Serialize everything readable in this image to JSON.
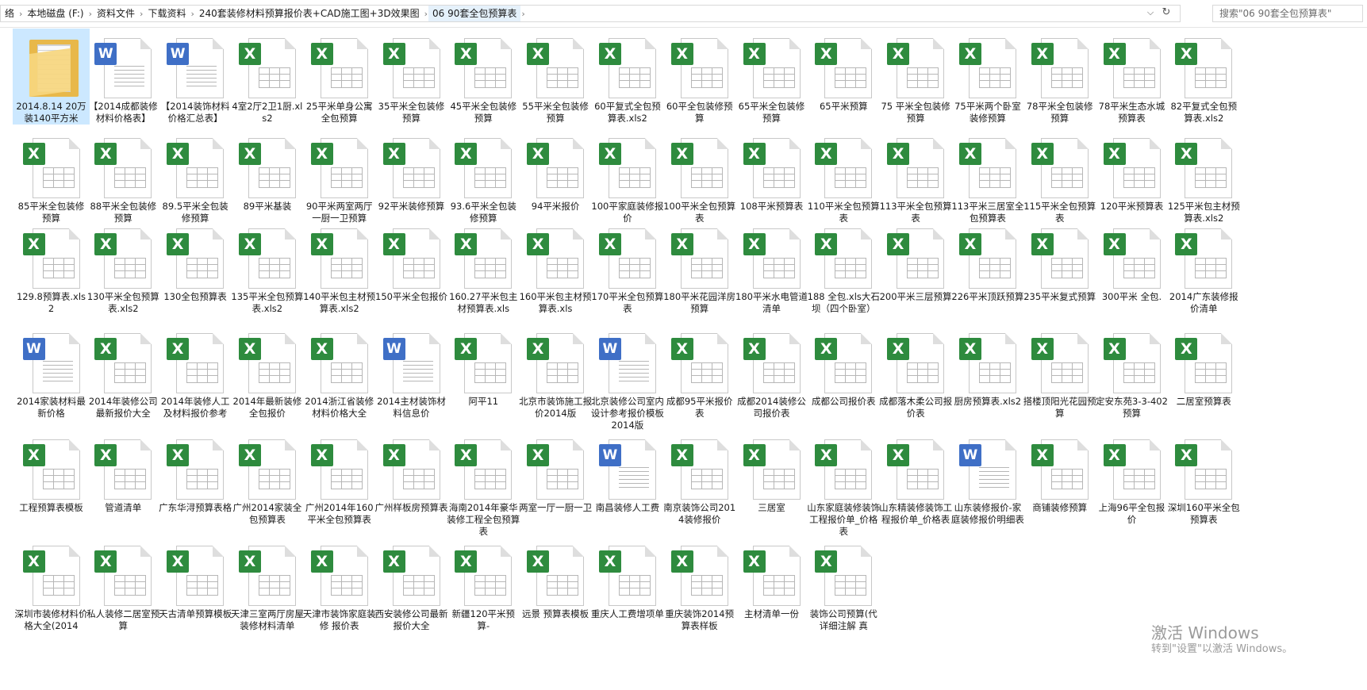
{
  "address": {
    "breadcrumbs": [
      "络",
      "本地磁盘 (F:)",
      "资料文件",
      "下载资料",
      "240套装修材料预算报价表+CAD施工图+3D效果图",
      "06 90套全包预算表"
    ],
    "separator": "›"
  },
  "icons": {
    "dropdown": "⌵",
    "refresh": "↻",
    "excel_letter": "X",
    "word_letter": "W"
  },
  "search": {
    "placeholder": "搜索\"06 90套全包预算表\""
  },
  "colors": {
    "excel_badge": "#2e8b3e",
    "word_badge": "#3f6fc6",
    "selection": "#cce8ff"
  },
  "files": [
    {
      "name": "2014.8.14 20万装140平方米",
      "type": "folder",
      "selected": true
    },
    {
      "name": "【2014成都装修材料价格表】",
      "type": "word"
    },
    {
      "name": "【2014装饰材料价格汇总表】",
      "type": "word"
    },
    {
      "name": "4室2厅2卫1厨.xls2",
      "type": "excel"
    },
    {
      "name": "25平米单身公寓全包预算",
      "type": "excel"
    },
    {
      "name": "35平米全包装修预算",
      "type": "excel"
    },
    {
      "name": "45平米全包装修预算",
      "type": "excel"
    },
    {
      "name": "55平米全包装修预算",
      "type": "excel"
    },
    {
      "name": "60平复式全包预算表.xls2",
      "type": "excel"
    },
    {
      "name": "60平全包装修预算",
      "type": "excel"
    },
    {
      "name": "65平米全包装修预算",
      "type": "excel"
    },
    {
      "name": "65平米预算",
      "type": "excel"
    },
    {
      "name": "75 平米全包装修预算",
      "type": "excel"
    },
    {
      "name": "75平米两个卧室装修预算",
      "type": "excel"
    },
    {
      "name": "78平米全包装修预算",
      "type": "excel"
    },
    {
      "name": "78平米生态水城预算表",
      "type": "excel"
    },
    {
      "name": "82平复式全包预算表.xls2",
      "type": "excel"
    },
    {
      "name": "85平米全包装修预算",
      "type": "excel"
    },
    {
      "name": "88平米全包装修预算",
      "type": "excel"
    },
    {
      "name": "89.5平米全包装修预算",
      "type": "excel"
    },
    {
      "name": "89平米基装",
      "type": "excel"
    },
    {
      "name": "90平米两室两厅一厨一卫预算",
      "type": "excel"
    },
    {
      "name": "92平米装修预算",
      "type": "excel"
    },
    {
      "name": "93.6平米全包装修预算",
      "type": "excel"
    },
    {
      "name": "94平米报价",
      "type": "excel"
    },
    {
      "name": "100平家庭装修报价",
      "type": "excel"
    },
    {
      "name": "100平米全包预算表",
      "type": "excel"
    },
    {
      "name": "108平米预算表",
      "type": "excel"
    },
    {
      "name": "110平米全包预算表",
      "type": "excel"
    },
    {
      "name": "113平米全包预算表",
      "type": "excel"
    },
    {
      "name": "113平米三居室全包预算表",
      "type": "excel"
    },
    {
      "name": "115平米全包预算表",
      "type": "excel"
    },
    {
      "name": "120平米预算表",
      "type": "excel"
    },
    {
      "name": "125平米包主材预算表.xls2",
      "type": "excel"
    },
    {
      "name": "129.8预算表.xls2",
      "type": "excel"
    },
    {
      "name": "130平米全包预算表.xls2",
      "type": "excel"
    },
    {
      "name": "130全包预算表",
      "type": "excel"
    },
    {
      "name": "135平米全包预算表.xls2",
      "type": "excel"
    },
    {
      "name": "140平米包主材预算表.xls2",
      "type": "excel"
    },
    {
      "name": "150平米全包报价",
      "type": "excel"
    },
    {
      "name": "160.27平米包主材预算表.xls",
      "type": "excel"
    },
    {
      "name": "160平米包主材预算表.xls",
      "type": "excel"
    },
    {
      "name": "170平米全包预算表",
      "type": "excel"
    },
    {
      "name": "180平米花园洋房预算",
      "type": "excel"
    },
    {
      "name": "180平米水电管道清单",
      "type": "excel"
    },
    {
      "name": "188 全包.xls大石坝（四个卧室）",
      "type": "excel"
    },
    {
      "name": "200平米三层预算",
      "type": "excel"
    },
    {
      "name": "226平米顶跃预算",
      "type": "excel"
    },
    {
      "name": "235平米复式预算",
      "type": "excel"
    },
    {
      "name": "300平米 全包.",
      "type": "excel"
    },
    {
      "name": "2014广东装修报价清单",
      "type": "excel"
    },
    {
      "name": "2014家装材料最新价格",
      "type": "word"
    },
    {
      "name": "2014年装修公司最新报价大全",
      "type": "excel"
    },
    {
      "name": "2014年装修人工及材料报价参考",
      "type": "excel"
    },
    {
      "name": "2014年最新装修全包报价",
      "type": "excel"
    },
    {
      "name": "2014浙江省装修材料价格大全",
      "type": "excel"
    },
    {
      "name": "2014主材装饰材料信息价",
      "type": "word"
    },
    {
      "name": "阿平11",
      "type": "excel"
    },
    {
      "name": "北京市装饰施工报价2014版",
      "type": "excel"
    },
    {
      "name": "北京装修公司室内设计参考报价模板2014版",
      "type": "word"
    },
    {
      "name": "成都95平米报价表",
      "type": "excel"
    },
    {
      "name": "成都2014装修公司报价表",
      "type": "excel"
    },
    {
      "name": "成都公司报价表",
      "type": "excel"
    },
    {
      "name": "成都落木柔公司报价表",
      "type": "excel"
    },
    {
      "name": "厨房预算表.xls2",
      "type": "excel"
    },
    {
      "name": "搭楼顶阳光花园预算",
      "type": "excel"
    },
    {
      "name": "定安东苑3-3-402预算",
      "type": "excel"
    },
    {
      "name": "二居室预算表",
      "type": "excel"
    },
    {
      "name": "工程预算表模板",
      "type": "excel"
    },
    {
      "name": "管道清单",
      "type": "excel"
    },
    {
      "name": "广东华浔预算表格",
      "type": "excel"
    },
    {
      "name": "广州2014家装全包预算表",
      "type": "excel"
    },
    {
      "name": "广州2014年160平米全包预算表",
      "type": "excel"
    },
    {
      "name": "广州样板房预算表",
      "type": "excel"
    },
    {
      "name": "海南2014年豪华装修工程全包预算表",
      "type": "excel"
    },
    {
      "name": "两室一厅一厨一卫",
      "type": "excel"
    },
    {
      "name": "南昌装修人工费",
      "type": "word"
    },
    {
      "name": "南京装饰公司2014装修报价",
      "type": "excel"
    },
    {
      "name": "三居室",
      "type": "excel"
    },
    {
      "name": "山东家庭装修装饰工程报价单_价格表",
      "type": "excel"
    },
    {
      "name": "山东精装修装饰工程报价单_价格表",
      "type": "excel"
    },
    {
      "name": "山东装修报价-家庭装修报价明细表",
      "type": "word"
    },
    {
      "name": "商铺装修预算",
      "type": "excel"
    },
    {
      "name": "上海96平全包报价",
      "type": "excel"
    },
    {
      "name": "深圳160平米全包预算表",
      "type": "excel"
    },
    {
      "name": "深圳市装修材料价格大全(2014",
      "type": "excel"
    },
    {
      "name": "私人装修二居室预算",
      "type": "excel"
    },
    {
      "name": "天古清单预算模板",
      "type": "excel"
    },
    {
      "name": "天津三室两厅房屋装修材料清单",
      "type": "excel"
    },
    {
      "name": "天津市装饰家庭装修 报价表",
      "type": "excel"
    },
    {
      "name": "西安装修公司最新报价大全",
      "type": "excel"
    },
    {
      "name": "新疆120平米预算-",
      "type": "excel"
    },
    {
      "name": "远景 预算表模板",
      "type": "excel"
    },
    {
      "name": "重庆人工费增项单",
      "type": "excel"
    },
    {
      "name": "重庆装饰2014预算表样板",
      "type": "excel"
    },
    {
      "name": "主材清单一份",
      "type": "excel"
    },
    {
      "name": "装饰公司预算(代详细注解 真",
      "type": "excel"
    }
  ],
  "watermark": {
    "title": "激活 Windows",
    "subtitle": "转到\"设置\"以激活 Windows。"
  }
}
